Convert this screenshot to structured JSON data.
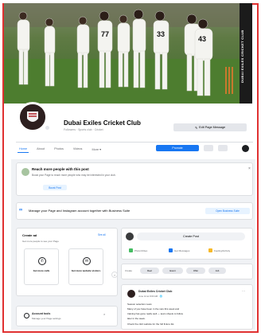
{
  "cover": {
    "side_label": "DUBAI EXILES CRICKET CLUB",
    "players": [
      {
        "number": ""
      },
      {
        "number": ""
      },
      {
        "number": ""
      },
      {
        "number": "77"
      },
      {
        "number": ""
      },
      {
        "number": ""
      },
      {
        "number": "33"
      },
      {
        "number": ""
      },
      {
        "number": "43"
      }
    ]
  },
  "profile": {
    "name": "Dubai Exiles Cricket Club",
    "subtitle": "Followers · Sports club · Cricket",
    "edit_button": "Edit Page Message"
  },
  "tabs": {
    "items": [
      "Home",
      "About",
      "Photos",
      "Videos",
      "More ▾"
    ],
    "promote": "Promote"
  },
  "reach": {
    "title": "Reach more people with this post",
    "text": "Boost your Page to reach more people who may be interested in your club.",
    "button": "Boost Post",
    "close": "×"
  },
  "business_suite": {
    "icon": "∞",
    "text": "Manage your Page and Instagram account together with Business Suite",
    "button": "Open Business Suite"
  },
  "left": {
    "title": "Create ad",
    "link": "See all",
    "subtitle": "Get more people to see your Page",
    "actions": [
      {
        "icon": "phone-icon",
        "glyph": "✆",
        "label": "Get more calls"
      },
      {
        "icon": "message-icon",
        "glyph": "✉",
        "label": "Get more website visitors"
      }
    ],
    "arrow": "›",
    "bottom_title": "Account tools",
    "bottom_sub": "Manage your Page settings",
    "bottom_close": "×"
  },
  "composer": {
    "create_post": "Create Post",
    "options": [
      {
        "label": "Photo/Video",
        "color": "#45bd62"
      },
      {
        "label": "Get Messages",
        "color": "#1877f2"
      },
      {
        "label": "Feeling/Activity",
        "color": "#f7b928"
      }
    ],
    "filter_label": "Create",
    "chips": [
      "Reel",
      "Event",
      "Offer",
      "Job"
    ]
  },
  "post": {
    "name": "Dubai Exiles Cricket Club",
    "meta": "June 14 at 9:00 AM · 🌐",
    "more": "···",
    "lines": [
      "Season selection news",
      "Many of you have been in the nets this week and",
      "training has gone really well — team sheets to follow",
      "later in the week.",
      "Check the club website for the full fixture list."
    ]
  }
}
